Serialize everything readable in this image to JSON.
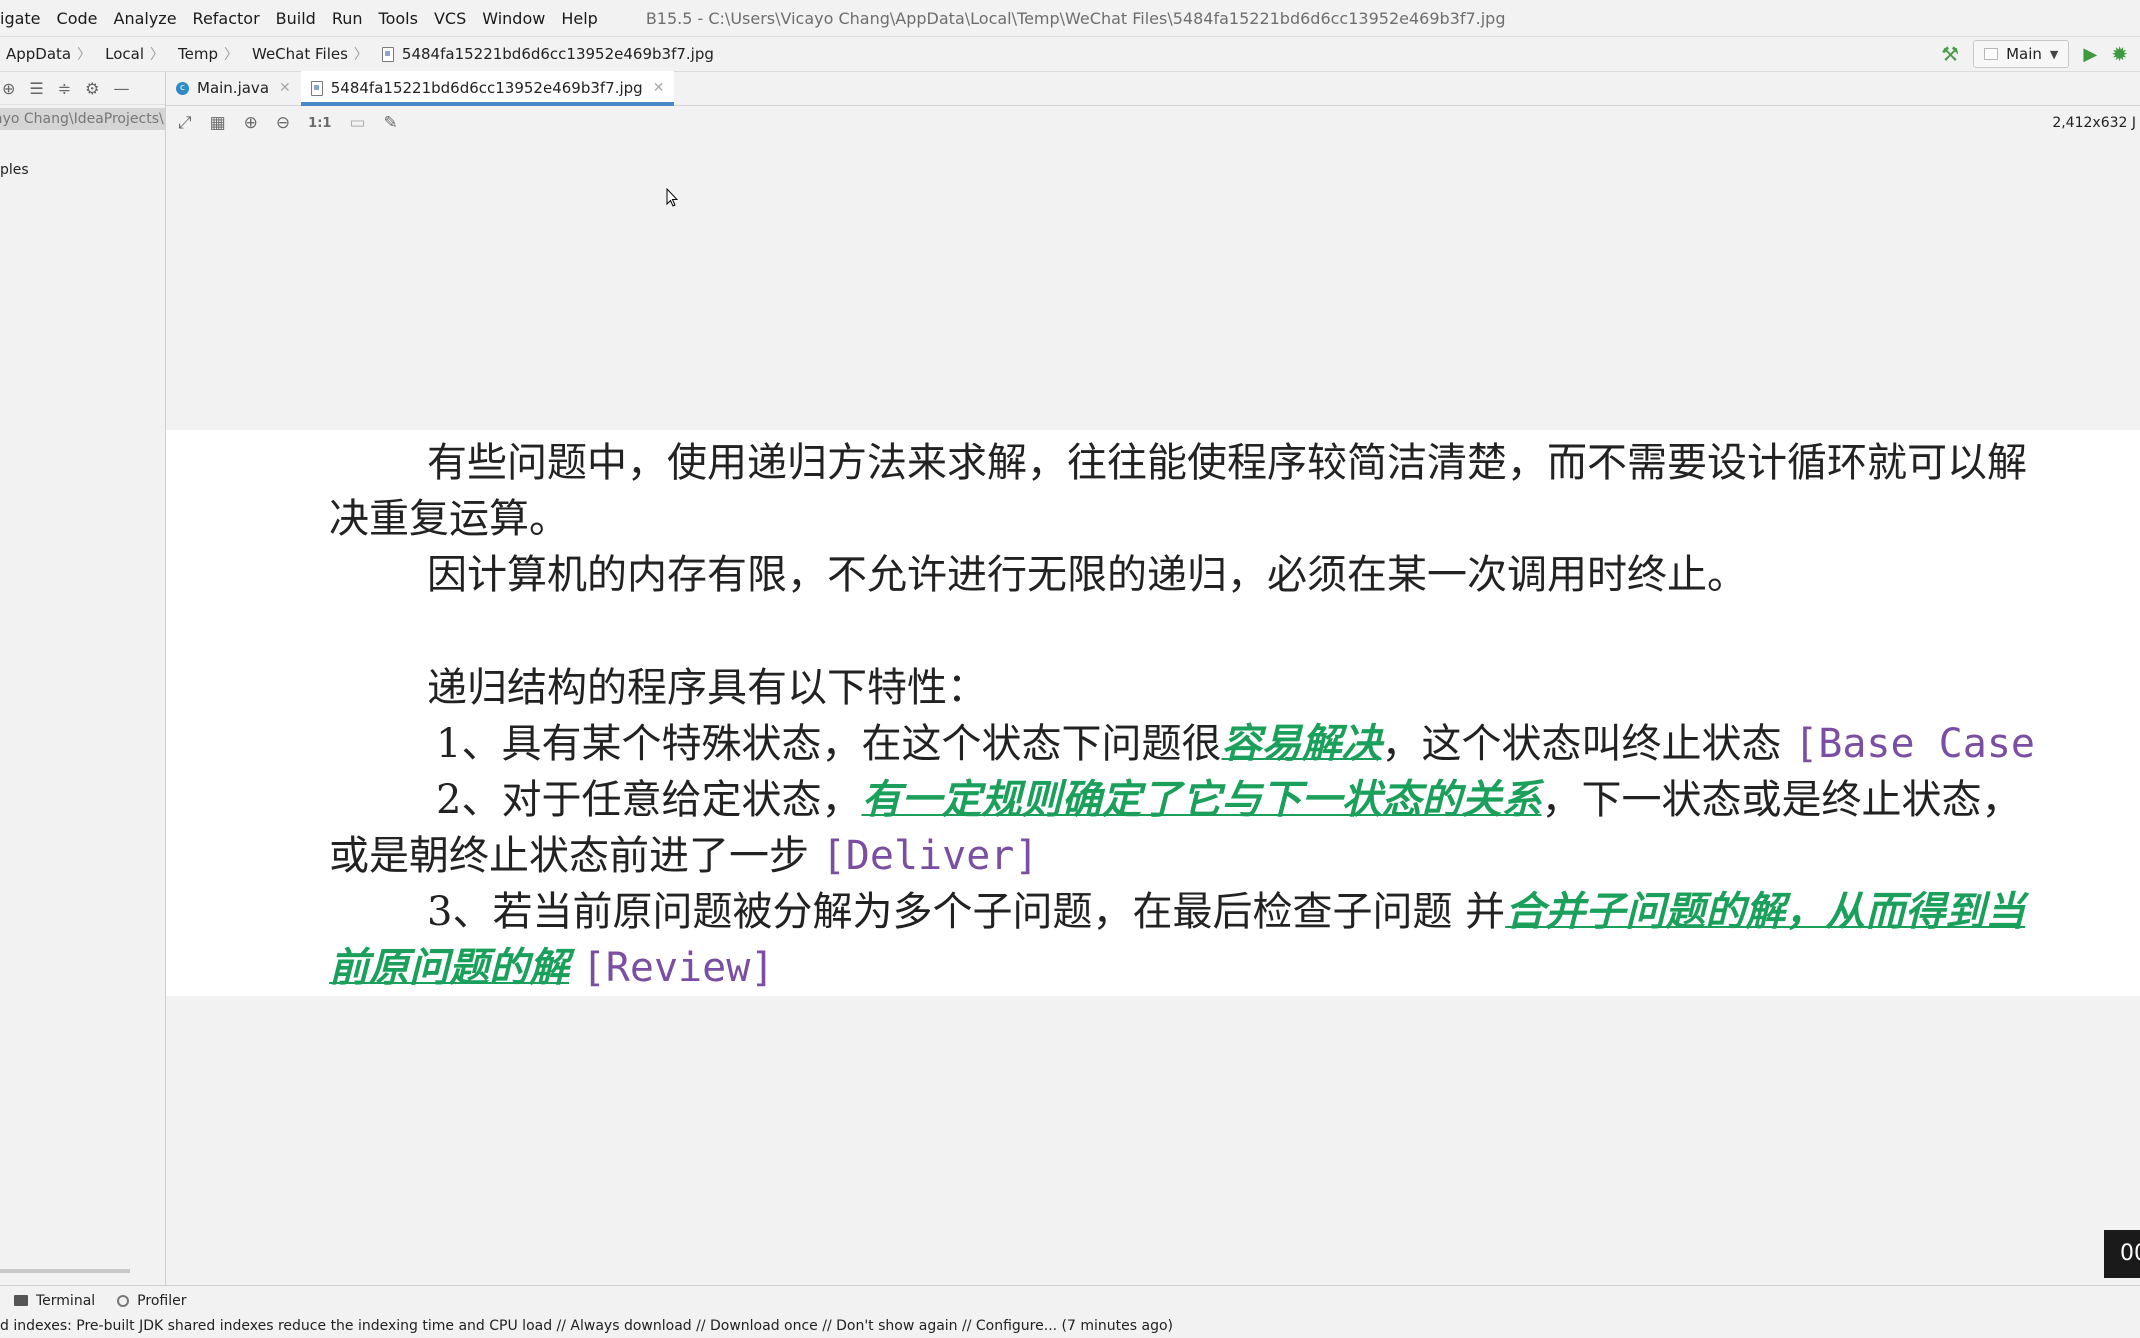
{
  "menu": {
    "items": [
      "igate",
      "Code",
      "Analyze",
      "Refactor",
      "Build",
      "Run",
      "Tools",
      "VCS",
      "Window",
      "Help"
    ],
    "window_title": "B15.5 - C:\\Users\\Vicayo Chang\\AppData\\Local\\Temp\\WeChat Files\\5484fa15221bd6d6cc13952e469b3f7.jpg"
  },
  "breadcrumbs": [
    "AppData",
    "Local",
    "Temp",
    "WeChat Files",
    "5484fa15221bd6d6cc13952e469b3f7.jpg"
  ],
  "run_config": {
    "label": "Main"
  },
  "sidebar": {
    "path": "ayo Chang\\IdeaProjects\\",
    "item": "ples"
  },
  "tabs": [
    {
      "label": "Main.java",
      "icon": "java-class-icon",
      "active": false
    },
    {
      "label": "5484fa15221bd6d6cc13952e469b3f7.jpg",
      "icon": "image-file-icon",
      "active": true
    }
  ],
  "image_toolbar": {
    "actual_size": "1:1",
    "info": "2,412x632 J"
  },
  "image_text": {
    "l1": "有些问题中，使用递归方法来求解，往往能使程序较简洁清楚，而不需要设计循环就可以解",
    "l2": "决重复运算。",
    "l3": "因计算机的内存有限，不允许进行无限的递归，必须在某一次调用时终止。",
    "l4": "递归结构的程序具有以下特性：",
    "l5_a": "1、具有某个特殊状态，在这个状态下问题很",
    "l5_hl": "容易解决",
    "l5_b": "，这个状态叫终止状态",
    "l5_tag": "[Base Case",
    "l6_a": "2、对于任意给定状态，",
    "l6_hl": "有一定规则确定了它与下一状态的关系",
    "l6_b": "，下一状态或是终止状态，",
    "l7_a": "或是朝终止状态前进了一步",
    "l7_tag": "[Deliver]",
    "l8_a": "3、若当前原问题被分解为多个子问题，在最后检查子问题 并",
    "l8_hl": "合并子问题的解，从而得到当",
    "l9_hl": "前原问题的解",
    "l9_tag": "[Review]"
  },
  "timer": "00",
  "tool_tabs": [
    "Terminal",
    "Profiler"
  ],
  "status": "d indexes: Pre-built JDK shared indexes reduce the indexing time and CPU load // Always download // Download once // Don't show again // Configure... (7 minutes ago)",
  "colors": {
    "highlight_green": "#1aa05a",
    "tag_purple": "#7a4fa3",
    "tab_underline": "#4a88c7"
  }
}
